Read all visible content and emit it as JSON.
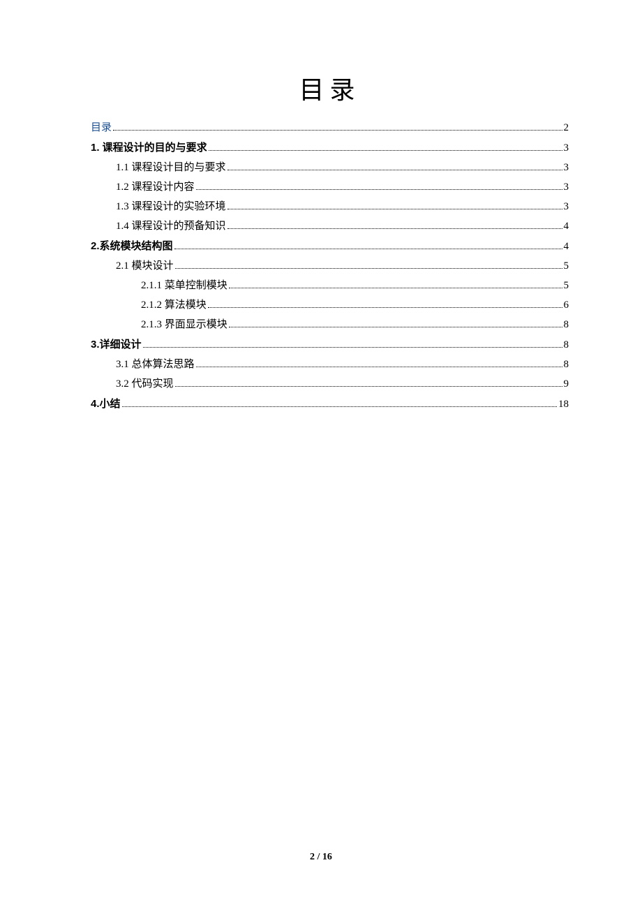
{
  "title": "目录",
  "footer": "2 / 16",
  "toc": [
    {
      "label": "目录",
      "page": "2",
      "indent": 0,
      "bold": false,
      "link": true
    },
    {
      "label": "1.  课程设计的目的与要求",
      "page": "3",
      "indent": 0,
      "bold": true,
      "link": false
    },
    {
      "label": "1.1 课程设计目的与要求",
      "page": "3",
      "indent": 1,
      "bold": false,
      "link": false
    },
    {
      "label": "1.2 课程设计内容",
      "page": "3",
      "indent": 1,
      "bold": false,
      "link": false
    },
    {
      "label": "1.3 课程设计的实验环境",
      "page": "3",
      "indent": 1,
      "bold": false,
      "link": false
    },
    {
      "label": "1.4 课程设计的预备知识",
      "page": "4",
      "indent": 1,
      "bold": false,
      "link": false
    },
    {
      "label": "2.系统模块结构图",
      "page": "4",
      "indent": 0,
      "bold": true,
      "link": false
    },
    {
      "label": "2.1  模块设计",
      "page": "5",
      "indent": 1,
      "bold": false,
      "link": false
    },
    {
      "label": "2.1.1  菜单控制模块",
      "page": "5",
      "indent": 2,
      "bold": false,
      "link": false
    },
    {
      "label": "2.1.2  算法模块",
      "page": "6",
      "indent": 2,
      "bold": false,
      "link": false
    },
    {
      "label": "2.1.3  界面显示模块",
      "page": "8",
      "indent": 2,
      "bold": false,
      "link": false
    },
    {
      "label": "3.详细设计",
      "page": "8",
      "indent": 0,
      "bold": true,
      "link": false
    },
    {
      "label": "3.1 总体算法思路",
      "page": "8",
      "indent": 1,
      "bold": false,
      "link": false
    },
    {
      "label": "3.2 代码实现",
      "page": "9",
      "indent": 1,
      "bold": false,
      "link": false
    },
    {
      "label": "4.小结",
      "page": "18",
      "indent": 0,
      "bold": true,
      "link": false
    }
  ]
}
